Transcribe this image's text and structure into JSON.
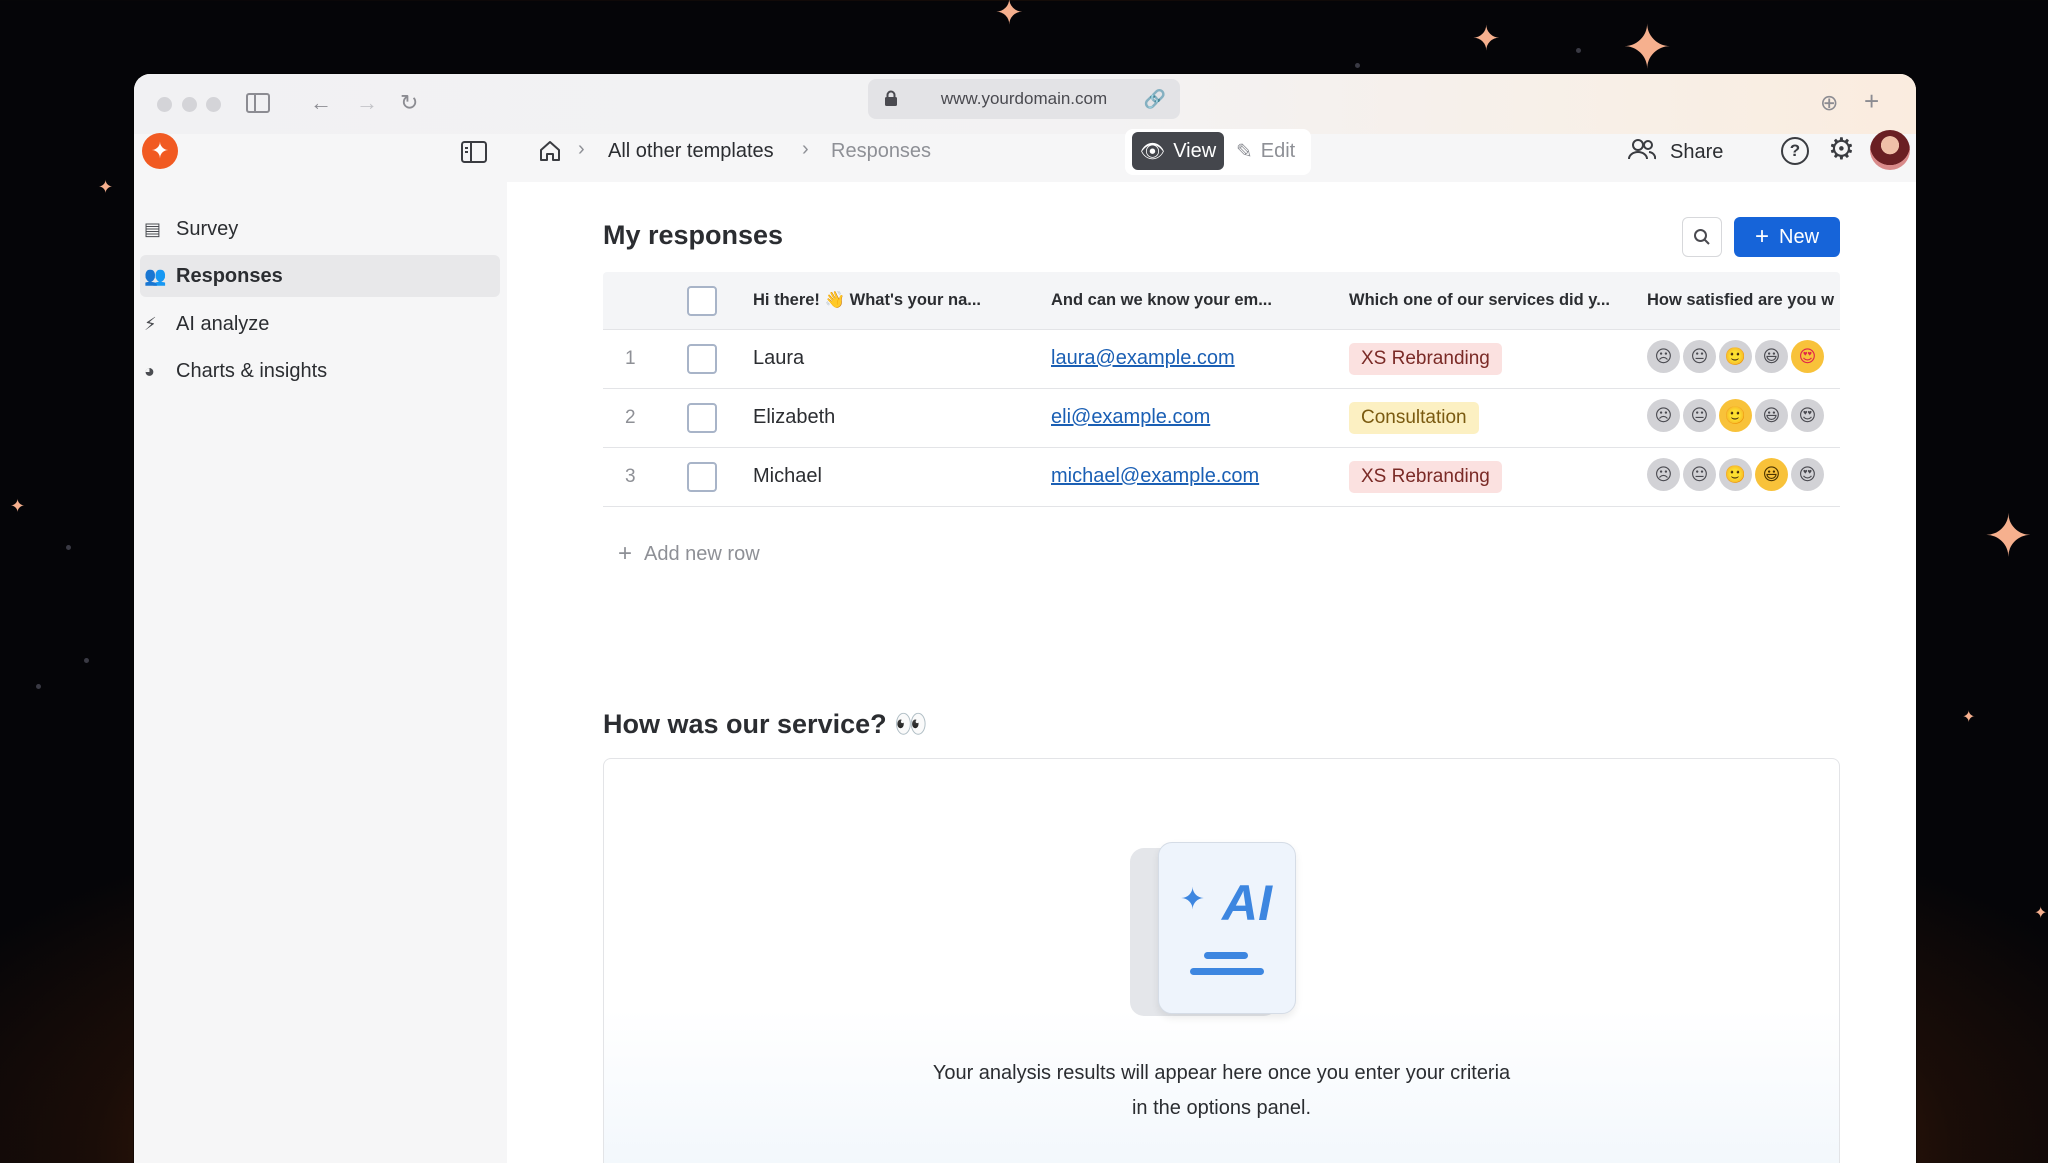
{
  "browser": {
    "url": "www.yourdomain.com"
  },
  "header": {
    "breadcrumbs": [
      "All other templates",
      "Responses"
    ],
    "view_label": "View",
    "edit_label": "Edit",
    "share_label": "Share"
  },
  "sidebar": {
    "items": [
      {
        "label": "Survey",
        "icon": "form-icon"
      },
      {
        "label": "Responses",
        "icon": "people-icon",
        "active": true
      },
      {
        "label": "AI analyze",
        "icon": "bolt-icon"
      },
      {
        "label": "Charts & insights",
        "icon": "pie-chart-icon"
      }
    ]
  },
  "responses": {
    "title": "My responses",
    "new_label": "New",
    "columns": [
      "Hi there! 👋 What's your na...",
      "And can we know your em...",
      "Which one of our services did y...",
      "How satisfied are you w"
    ],
    "rows": [
      {
        "num": "1",
        "name": "Laura",
        "email": "laura@example.com",
        "service": "XS Rebranding",
        "service_color": "red",
        "rating": 5
      },
      {
        "num": "2",
        "name": "Elizabeth",
        "email": "eli@example.com",
        "service": "Consultation",
        "service_color": "yellow",
        "rating": 3
      },
      {
        "num": "3",
        "name": "Michael",
        "email": "michael@example.com",
        "service": "XS Rebranding",
        "service_color": "red",
        "rating": 4
      }
    ],
    "add_row_label": "Add new row"
  },
  "analysis": {
    "title": "How was our service? 👀",
    "ai_label": "AI",
    "message_line1": "Your analysis results will appear here once you enter your criteria",
    "message_line2": "in the options panel."
  },
  "colors": {
    "accent": "#1664d9",
    "brand": "#f15a22",
    "tag_red": "#fbe1e0",
    "tag_yellow": "#fcf0c2"
  }
}
